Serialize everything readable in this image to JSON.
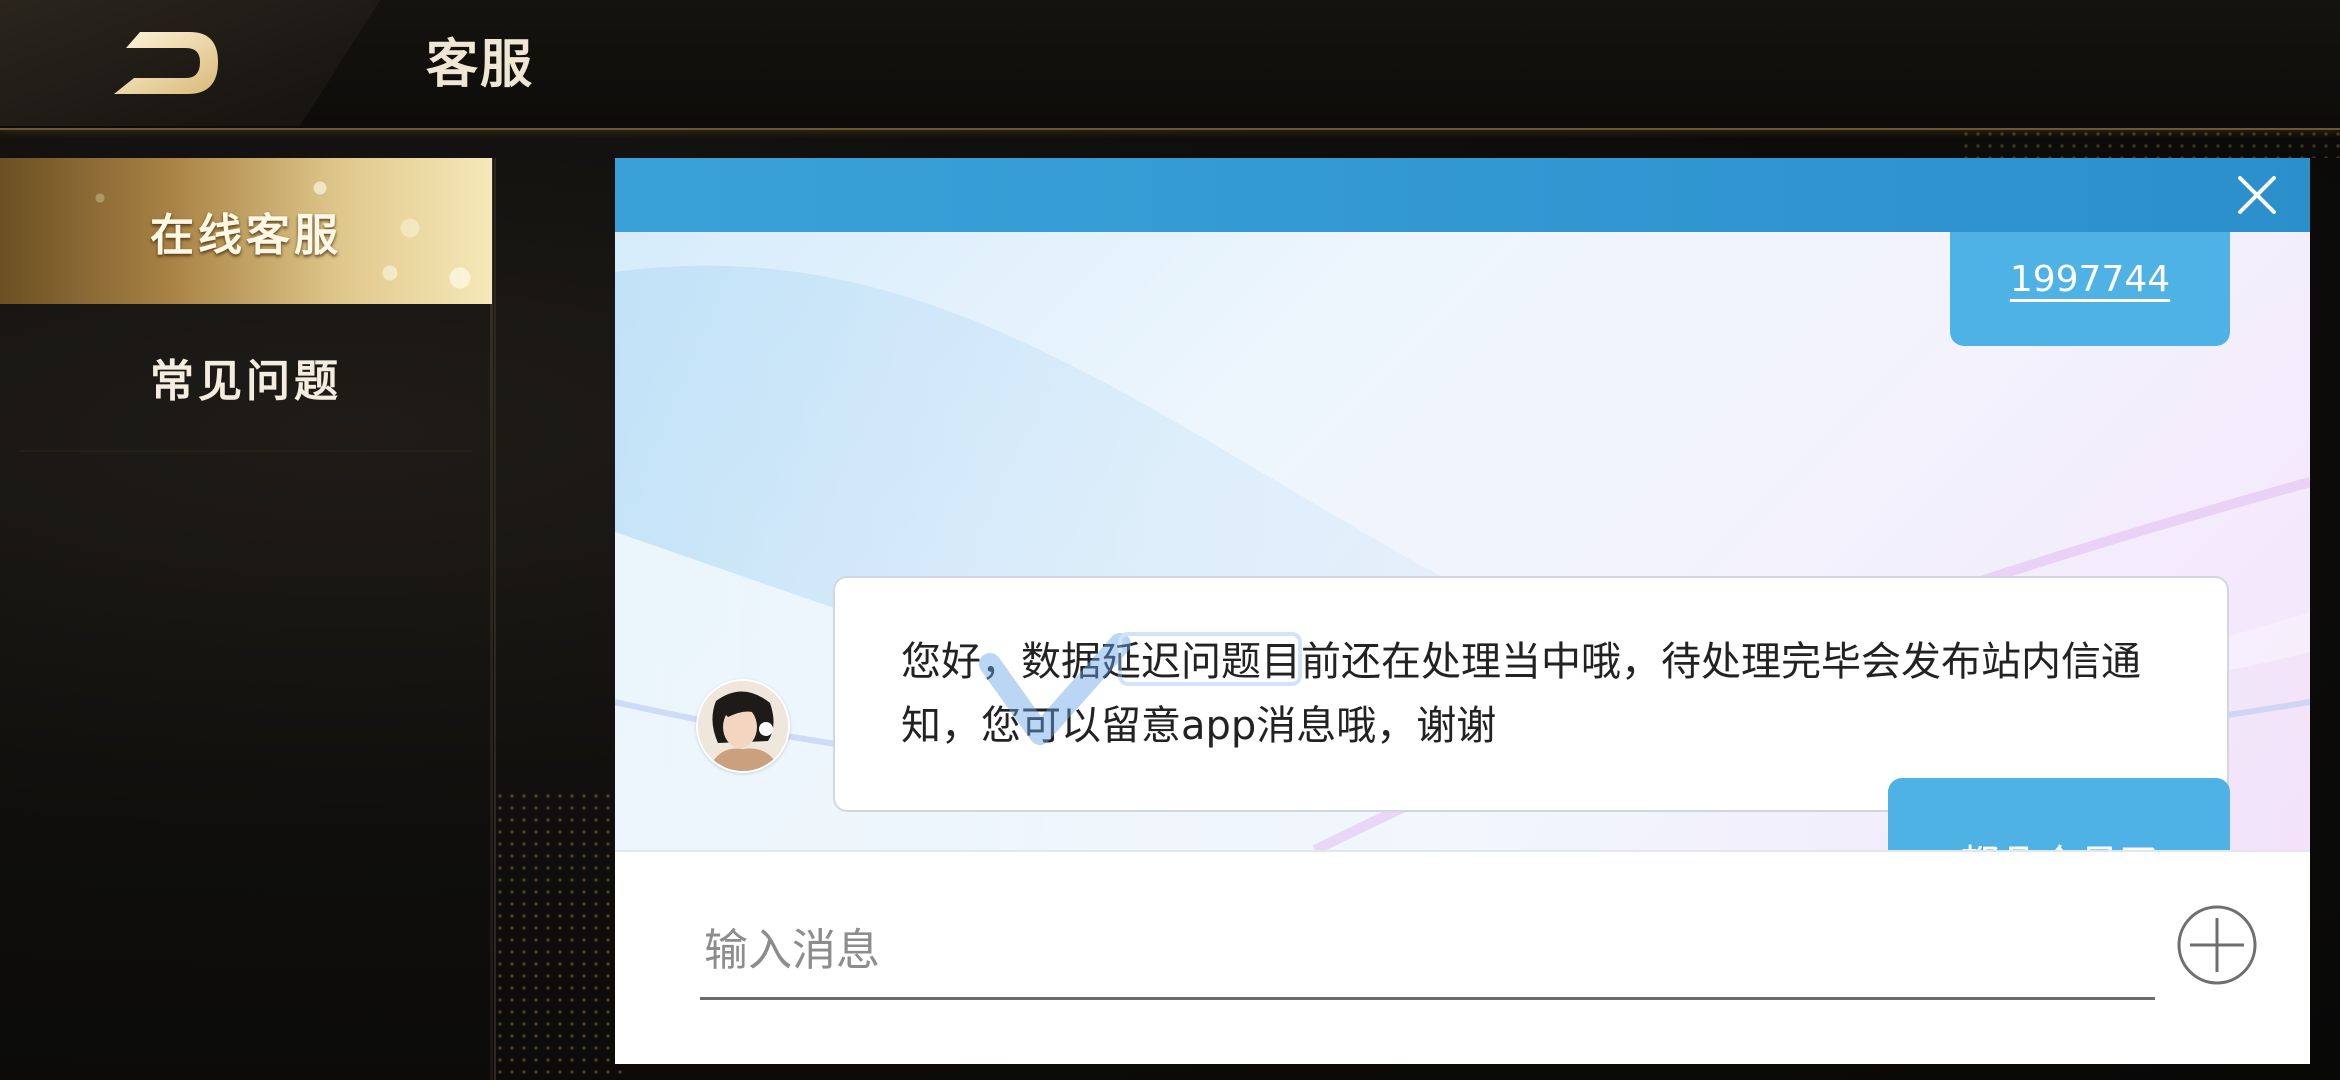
{
  "header": {
    "title": "客服",
    "back_icon": "back-arrow-icon"
  },
  "sidebar": {
    "items": [
      {
        "label": "在线客服",
        "active": true
      },
      {
        "label": "常见问题",
        "active": false
      }
    ]
  },
  "chat": {
    "close_icon": "close-icon",
    "messages": [
      {
        "from": "user",
        "text": "1997744"
      },
      {
        "from": "agent",
        "text": "您好，数据延迟问题目前还在处理当中哦，待处理完毕会发布站内信通知，您可以留意app消息哦，谢谢"
      },
      {
        "from": "user",
        "text": "都几个月了"
      }
    ],
    "input": {
      "placeholder": "输入消息",
      "value": ""
    },
    "add_icon": "plus-circle-icon"
  },
  "colors": {
    "accent_blue": "#2b8fcc",
    "user_bubble": "#4fb2e5",
    "gold": "#e1c98d"
  }
}
